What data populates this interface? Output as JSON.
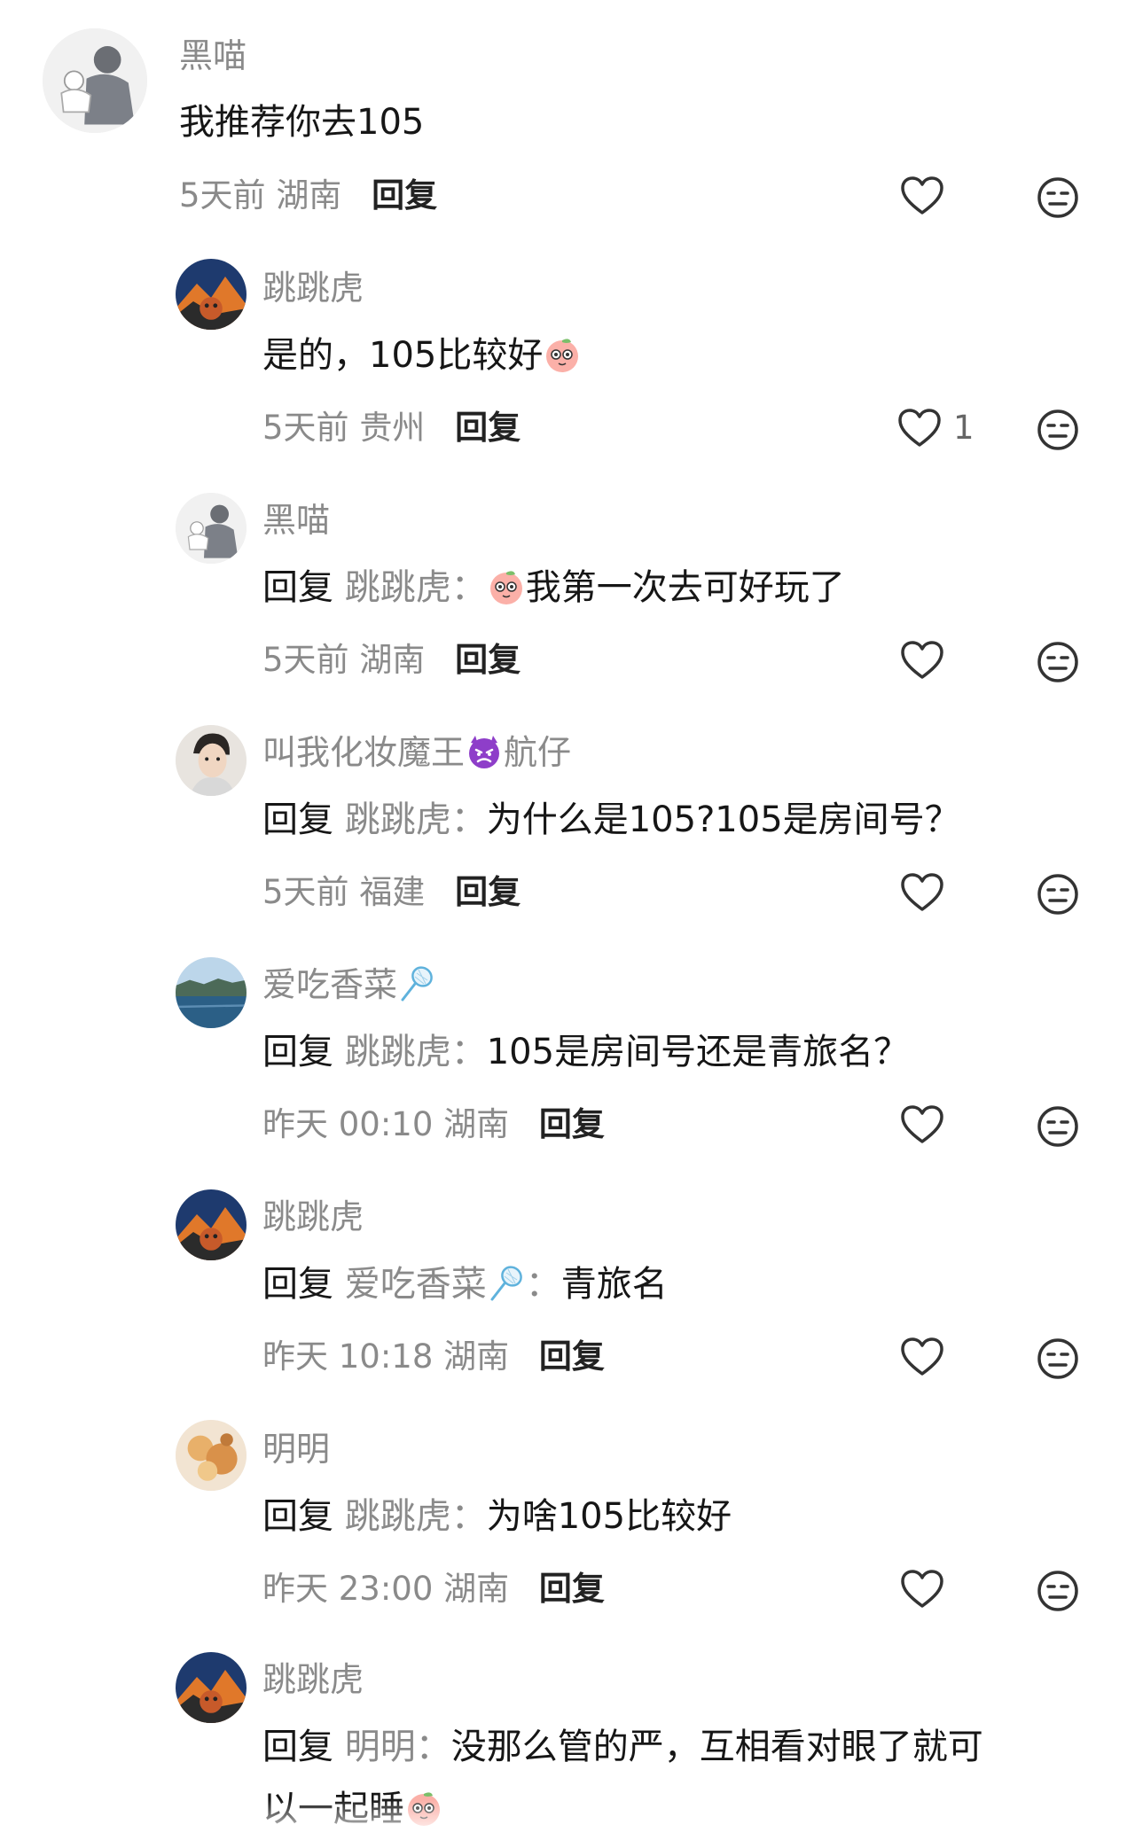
{
  "comments": [
    {
      "name": "黑喵",
      "text": "我推荐你去105",
      "time": "5天前",
      "location": "湖南",
      "reply_label": "回复",
      "likes": ""
    },
    {
      "name": "跳跳虎",
      "text": "是的，105比较好",
      "emoji": "peach-face-emoji",
      "time": "5天前",
      "location": "贵州",
      "reply_label": "回复",
      "likes": "1"
    },
    {
      "name": "黑喵",
      "reply_word": "回复",
      "reply_target": "跳跳虎：",
      "text": "我第一次去可好玩了",
      "emoji": "peach-face-emoji",
      "time": "5天前",
      "location": "湖南",
      "reply_label": "回复",
      "likes": ""
    },
    {
      "name": "叫我化妆魔王",
      "name_suffix": "航仔",
      "name_emoji": "angry-devil-emoji",
      "reply_word": "回复",
      "reply_target": "跳跳虎：",
      "text": "为什么是105?105是房间号？",
      "time": "5天前",
      "location": "福建",
      "reply_label": "回复",
      "likes": ""
    },
    {
      "name": "爱吃香菜",
      "name_emoji": "badminton-racket-emoji",
      "reply_word": "回复",
      "reply_target": "跳跳虎：",
      "text": "105是房间号还是青旅名？",
      "time": "昨天 00:10",
      "location": "湖南",
      "reply_label": "回复",
      "likes": ""
    },
    {
      "name": "跳跳虎",
      "reply_word": "回复",
      "reply_target": "爱吃香菜",
      "reply_target_suffix": "：",
      "text": "青旅名",
      "time": "昨天 10:18",
      "location": "湖南",
      "reply_label": "回复",
      "likes": ""
    },
    {
      "name": "明明",
      "reply_word": "回复",
      "reply_target": "跳跳虎：",
      "text": "为啥105比较好",
      "time": "昨天 23:00",
      "location": "湖南",
      "reply_label": "回复",
      "likes": ""
    },
    {
      "name": "跳跳虎",
      "reply_word": "回复",
      "reply_target": "明明：",
      "text": "没那么管的严，互相看对眼了就可",
      "text_line2": "以一起睡",
      "emoji": "peach-face-emoji"
    }
  ],
  "icons": {
    "like": "heart-outline-icon",
    "dislike": "neutral-face-icon"
  },
  "colors": {
    "name_gray": "#8a8a8a",
    "text": "#161616",
    "icon_gray": "#333333"
  }
}
